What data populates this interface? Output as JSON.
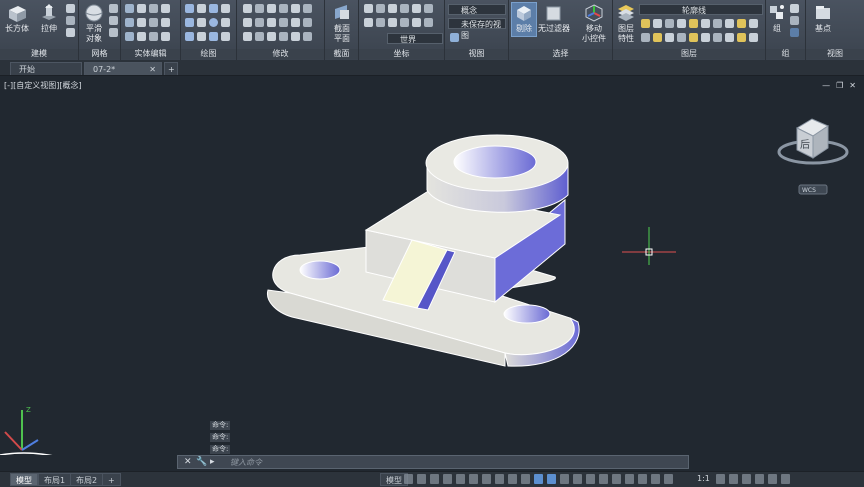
{
  "ribbon": {
    "panels": [
      {
        "title": "建模"
      },
      {
        "title": "网格"
      },
      {
        "title": "实体编辑"
      },
      {
        "title": "绘图"
      },
      {
        "title": "修改"
      },
      {
        "title": "截面"
      },
      {
        "title": "坐标"
      },
      {
        "title": "视图"
      },
      {
        "title": "选择"
      },
      {
        "title": "图层"
      },
      {
        "title": "组"
      },
      {
        "title": "视图"
      }
    ],
    "buttons": {
      "box": "长方体",
      "extrude": "拉伸",
      "smooth": "平滑\n对象",
      "section_plane": "截面\n平面",
      "culling": "剔除",
      "no_filter": "无过滤器",
      "gizmo": "移动\n小控件",
      "layer_props": "图层\n特性",
      "group": "组",
      "base": "基点"
    },
    "combos": {
      "visual_style": "概念",
      "saved_view": "未保存的视图",
      "ucs": "世界",
      "layer": "轮廓线"
    }
  },
  "doc_tabs": [
    {
      "label": "开始"
    },
    {
      "label": "07-2*"
    }
  ],
  "viewport": {
    "label": "[-][自定义视图][概念]",
    "viewcube_face": "后",
    "wcs_label": "WCS"
  },
  "command": {
    "history": [
      "命令:",
      "命令:",
      "命令:"
    ],
    "placeholder": "键入命令"
  },
  "layout_tabs": [
    {
      "label": "模型",
      "active": true
    },
    {
      "label": "布局1",
      "active": false
    },
    {
      "label": "布局2",
      "active": false
    }
  ],
  "status": {
    "model": "模型",
    "scale": "1:1"
  },
  "colors": {
    "viewport_bg": "#212830",
    "part_face": "#e6e6e0",
    "part_shade": "#6e6ed6",
    "rib_face": "#f5f5d6"
  }
}
